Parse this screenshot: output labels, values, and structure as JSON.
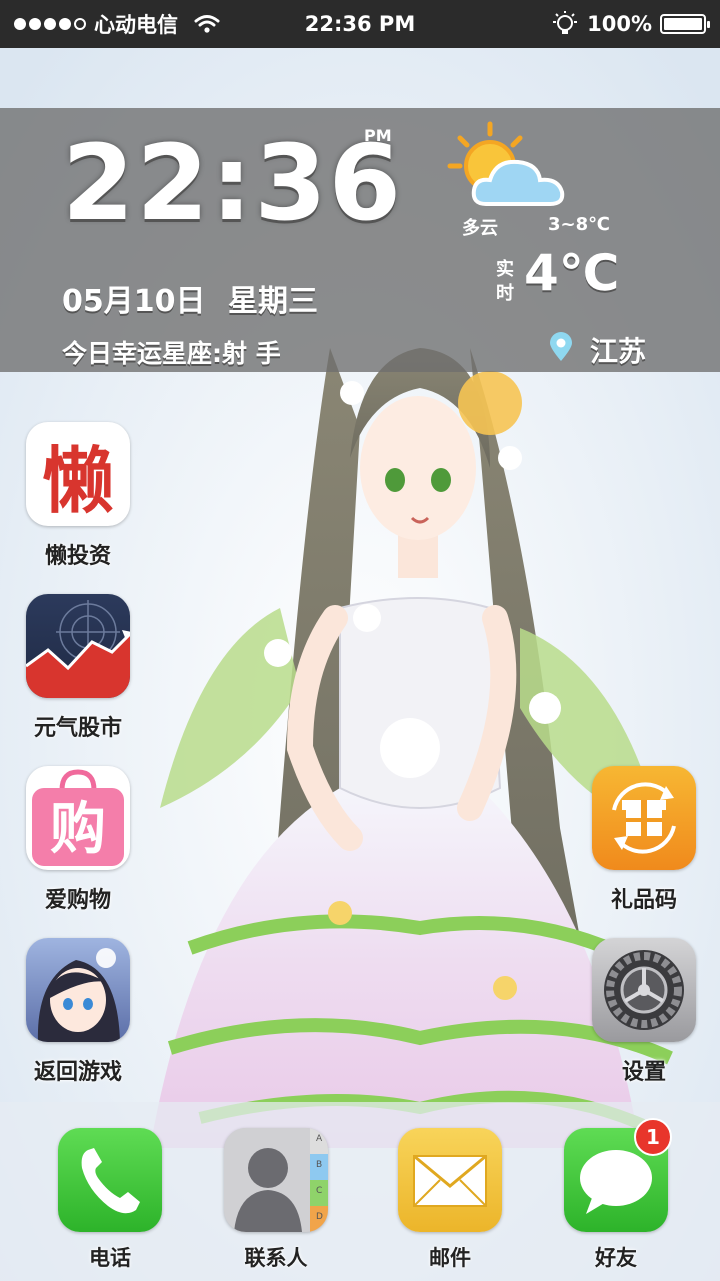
{
  "status_bar": {
    "carrier": "心动电信",
    "time": "22:36 PM",
    "battery": "100%",
    "battery_level": 1.0,
    "signal_bars_filled": 4,
    "signal_bars_total": 5
  },
  "widget": {
    "time": "22:36",
    "ampm": "PM",
    "date": "05月10日",
    "weekday": "星期三",
    "lucky": "今日幸运星座:射 手",
    "weather_icon": "partly-cloudy-icon",
    "condition": "多云",
    "range": "3~8℃",
    "realtime_label": "实时",
    "temperature": "4℃",
    "location": "江苏"
  },
  "apps": [
    {
      "label": "懒投资",
      "icon": "lantouzi-icon",
      "glyph": "懒"
    },
    {
      "label": "元气股市",
      "icon": "stock-chart-icon"
    },
    {
      "label": "爱购物",
      "icon": "shopping-bag-icon",
      "glyph": "购"
    },
    {
      "label": "返回游戏",
      "icon": "game-avatar-icon"
    },
    {
      "label": "礼品码",
      "icon": "gift-icon"
    },
    {
      "label": "设置",
      "icon": "gear-icon"
    }
  ],
  "dock": [
    {
      "label": "电话",
      "icon": "phone-icon"
    },
    {
      "label": "联系人",
      "icon": "contacts-icon",
      "tabs": [
        "A",
        "B",
        "C",
        "D"
      ]
    },
    {
      "label": "邮件",
      "icon": "mail-icon"
    },
    {
      "label": "好友",
      "icon": "messages-icon",
      "badge": "1"
    }
  ],
  "colors": {
    "status_bar": "#2b2b2b",
    "phone_green": "#3fc43c",
    "badge_red": "#e8352b",
    "mail_yellow": "#f3c53e",
    "gift_orange": "#f4a623"
  }
}
